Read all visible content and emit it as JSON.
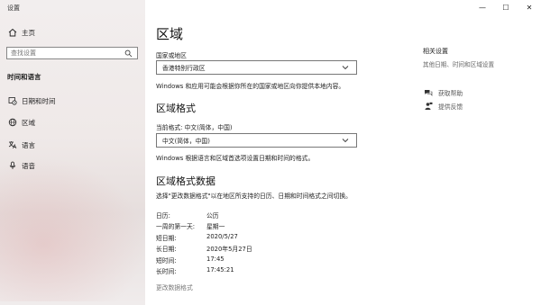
{
  "window": {
    "title": "设置",
    "controls": {
      "minimize": "—",
      "maximize": "☐",
      "close": "✕"
    }
  },
  "sidebar": {
    "home_label": "主页",
    "search_placeholder": "查找设置",
    "section_title": "时间和语言",
    "items": [
      {
        "label": "日期和时间",
        "icon": "calendar-clock-icon"
      },
      {
        "label": "区域",
        "icon": "globe-icon"
      },
      {
        "label": "语言",
        "icon": "language-icon"
      },
      {
        "label": "语音",
        "icon": "microphone-icon"
      }
    ]
  },
  "main": {
    "title": "区域",
    "country_label": "国家或地区",
    "country_value": "香港特别行政区",
    "country_desc": "Windows 和应用可能会根据你所在的国家或地区向你提供本地内容。",
    "format_heading": "区域格式",
    "current_format_label": "当前格式: 中文(简体，中国)",
    "format_value": "中文(简体，中国)",
    "format_desc": "Windows 根据语言和区域首选项设置日期和时间的格式。",
    "data_heading": "区域格式数据",
    "data_desc": "选择\"更改数据格式\"以在地区所支持的日历、日期和时间格式之间切换。",
    "data_rows": [
      {
        "key": "日历:",
        "value": "公历"
      },
      {
        "key": "一周的第一天:",
        "value": "星期一"
      },
      {
        "key": "短日期:",
        "value": "2020/5/27"
      },
      {
        "key": "长日期:",
        "value": "2020年5月27日"
      },
      {
        "key": "短时间:",
        "value": "17:45"
      },
      {
        "key": "长时间:",
        "value": "17:45:21"
      }
    ],
    "change_format_link": "更改数据格式"
  },
  "related": {
    "title": "相关设置",
    "link": "其他日期、时间和区域设置",
    "get_help": "获取帮助",
    "feedback": "提供反馈"
  }
}
